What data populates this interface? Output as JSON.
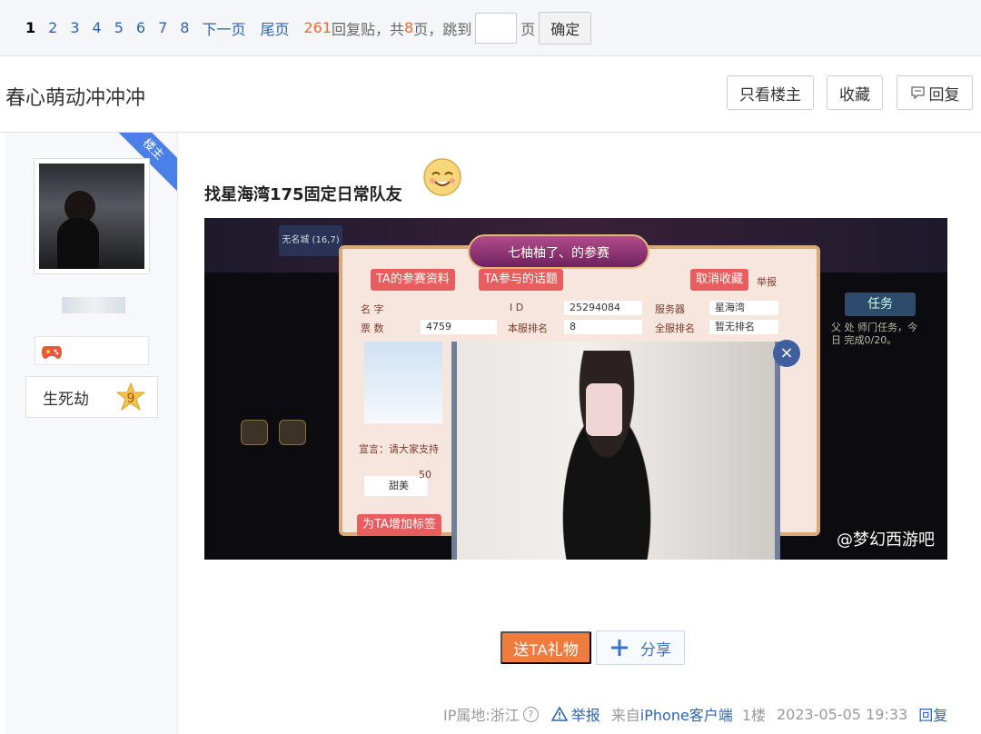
{
  "pager": {
    "pages": [
      "1",
      "2",
      "3",
      "4",
      "5",
      "6",
      "7",
      "8"
    ],
    "next": "下一页",
    "last": "尾页",
    "reply_count": "261",
    "reply_text": "回复贴，共",
    "page_count": "8",
    "page_text": "页，跳到",
    "page_unit": "页",
    "confirm": "确定"
  },
  "thread": {
    "title": "春心萌动冲冲冲",
    "only_op": "只看楼主",
    "favorite": "收藏",
    "reply": "回复"
  },
  "user": {
    "op_badge": "楼主",
    "level_name": "生死劫",
    "level_num": "9"
  },
  "post": {
    "title": "找星海湾175固定日常队友",
    "image": {
      "ribbon": "七柚柚了、的参赛",
      "tag_profile": "TA的参赛资料",
      "tag_topics": "TA参与的话题",
      "tag_unfav": "取消收藏",
      "report": "举报",
      "name_lbl": "名 字",
      "id_lbl": "I D",
      "id_val": "25294084",
      "server_lbl": "服务器",
      "server_val": "星海湾",
      "votes_lbl": "票 数",
      "votes_val": "4759",
      "rank_lbl": "本服排名",
      "rank_val": "8",
      "all_rank_lbl": "全服排名",
      "all_rank_val": "暂无排名",
      "declare": "宣言：请大家支持",
      "sweet": "甜美",
      "sweet_num": "50",
      "add_tag": "为TA增加标签",
      "task": "任务",
      "side_text": "父 处 师门任务，今日 完成0/20。",
      "watermark": "@梦幻西游吧",
      "top_left": "无名城 (16,7)"
    }
  },
  "actions": {
    "gift": "送TA礼物",
    "share": "分享"
  },
  "meta": {
    "ip": "IP属地:浙江",
    "report": "举报",
    "client_prefix": "来自",
    "client": "iPhone客户端",
    "floor": "1楼",
    "time": "2023-05-05 19:33",
    "reply": "回复"
  }
}
